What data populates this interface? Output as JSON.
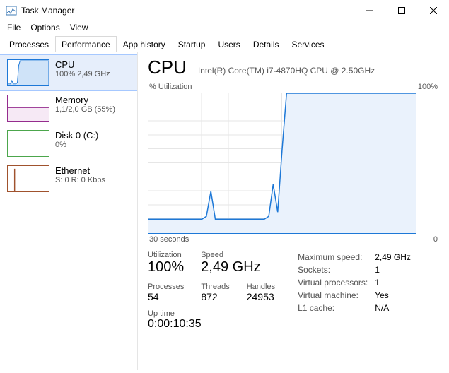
{
  "window": {
    "title": "Task Manager"
  },
  "menu": {
    "file": "File",
    "options": "Options",
    "view": "View"
  },
  "tabs": {
    "processes": "Processes",
    "performance": "Performance",
    "app_history": "App history",
    "startup": "Startup",
    "users": "Users",
    "details": "Details",
    "services": "Services"
  },
  "sidebar": {
    "cpu": {
      "title": "CPU",
      "sub": "100%  2,49 GHz"
    },
    "memory": {
      "title": "Memory",
      "sub": "1,1/2,0 GB (55%)"
    },
    "disk": {
      "title": "Disk 0 (C:)",
      "sub": "0%"
    },
    "ethernet": {
      "title": "Ethernet",
      "sub": "S: 0 R: 0 Kbps"
    }
  },
  "header": {
    "title": "CPU",
    "subtitle": "Intel(R) Core(TM) i7-4870HQ CPU @ 2.50GHz"
  },
  "chart": {
    "top_left": "% Utilization",
    "top_right": "100%",
    "bottom_left": "30 seconds",
    "bottom_right": "0"
  },
  "stats": {
    "utilization_label": "Utilization",
    "utilization": "100%",
    "speed_label": "Speed",
    "speed": "2,49 GHz",
    "processes_label": "Processes",
    "processes": "54",
    "threads_label": "Threads",
    "threads": "872",
    "handles_label": "Handles",
    "handles": "24953",
    "max_speed_label": "Maximum speed:",
    "max_speed": "2,49 GHz",
    "sockets_label": "Sockets:",
    "sockets": "1",
    "vprocs_label": "Virtual processors:",
    "vprocs": "1",
    "vm_label": "Virtual machine:",
    "vm": "Yes",
    "l1_label": "L1 cache:",
    "l1": "N/A"
  },
  "uptime": {
    "label": "Up time",
    "value": "0:00:10:35"
  },
  "chart_data": {
    "type": "line",
    "title": "% Utilization",
    "xlabel": "30 seconds",
    "ylabel": "% Utilization",
    "ylim": [
      0,
      100
    ],
    "x_start_seconds": 30,
    "x_end_seconds": 0,
    "series": [
      {
        "name": "CPU",
        "color": "#1d78d7",
        "values_pct": [
          10,
          10,
          10,
          10,
          10,
          10,
          10,
          10,
          10,
          10,
          10,
          10,
          10,
          12,
          30,
          10,
          10,
          10,
          10,
          10,
          10,
          10,
          10,
          10,
          10,
          10,
          10,
          12,
          35,
          15,
          60,
          100,
          100,
          100,
          100,
          100,
          100,
          100,
          100,
          100,
          100,
          100,
          100,
          100,
          100,
          100,
          100,
          100,
          100,
          100,
          100,
          100,
          100,
          100,
          100,
          100,
          100,
          100,
          100,
          100,
          100
        ]
      }
    ]
  }
}
